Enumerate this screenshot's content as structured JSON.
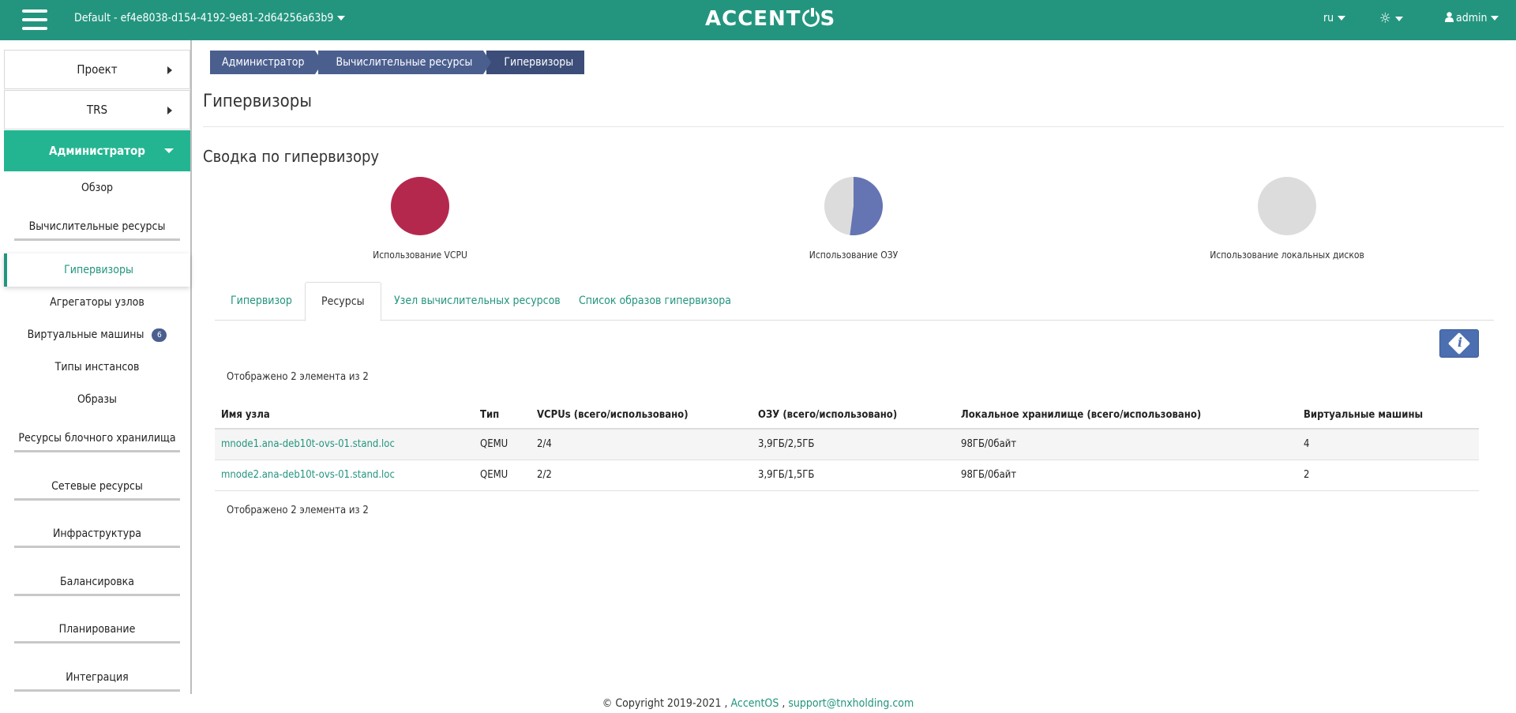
{
  "header": {
    "project": "Default - ef4e8038-d154-4192-9e81-2d64256a63b9",
    "logo_left": "ACCENT",
    "logo_right": "S",
    "lang": "ru",
    "user": "admin"
  },
  "sidebar": {
    "sections": [
      "Проект",
      "TRS",
      "Администратор"
    ],
    "items": [
      "Обзор",
      "Вычислительные ресурсы",
      "Гипервизоры",
      "Агрегаторы узлов",
      "Виртуальные машины",
      "Типы инстансов",
      "Образы",
      "Ресурсы блочного хранилища",
      "Сетевые ресурсы",
      "Инфраструктура",
      "Балансировка",
      "Планирование",
      "Интеграция"
    ],
    "vm_badge": "6"
  },
  "breadcrumb": [
    "Администратор",
    "Вычислительные ресурсы",
    "Гипервизоры"
  ],
  "page_title": "Гипервизоры",
  "summary": {
    "title": "Сводка по гипервизору",
    "charts": [
      {
        "label": "Использование VCPU",
        "used_fraction": 1.0,
        "color": "#b5284e"
      },
      {
        "label": "Использование ОЗУ",
        "used_fraction": 0.52,
        "color": "#6574b3"
      },
      {
        "label": "Использование локальных дисков",
        "used_fraction": 0.0,
        "color": "#dcdcdc"
      }
    ]
  },
  "tabs": [
    "Гипервизор",
    "Ресурсы",
    "Узел вычислительных ресурсов",
    "Список образов гипервизора"
  ],
  "active_tab": "Ресурсы",
  "table": {
    "count_text": "Отображено 2 элемента из 2",
    "headers": [
      "Имя узла",
      "Тип",
      "VCPUs (всего/использовано)",
      "ОЗУ (всего/использовано)",
      "Локальное хранилище (всего/использовано)",
      "Виртуальные машины"
    ],
    "rows": [
      [
        "mnode1.ana-deb10t-ovs-01.stand.loc",
        "QEMU",
        "2/4",
        "3,9ГБ/2,5ГБ",
        "98ГБ/0байт",
        "4"
      ],
      [
        "mnode2.ana-deb10t-ovs-01.stand.loc",
        "QEMU",
        "2/2",
        "3,9ГБ/1,5ГБ",
        "98ГБ/0байт",
        "2"
      ]
    ]
  },
  "footer": {
    "copyright": "© Copyright 2019-2021 ,",
    "brand": "AccentOS",
    "sep": ",",
    "email": "support@tnxholding.com"
  },
  "colors": {
    "topbar": "#23957f",
    "accent": "#23b591",
    "breadcrumb": "#4b5f8f"
  }
}
